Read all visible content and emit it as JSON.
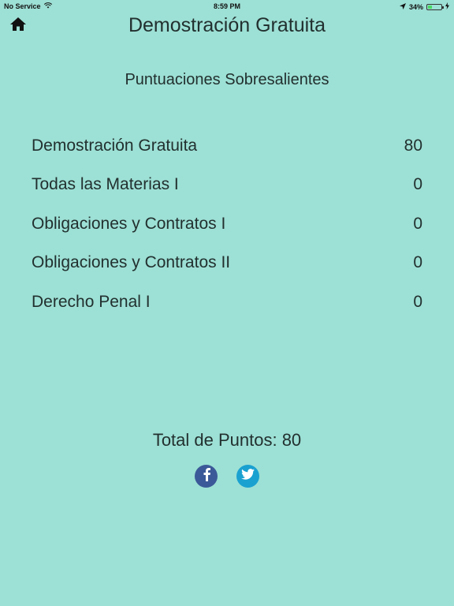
{
  "status_bar": {
    "carrier": "No Service",
    "time": "8:59 PM",
    "battery_percent": "34%",
    "battery_level": 0.34,
    "icons": [
      "wifi-icon",
      "location-arrow-icon",
      "battery-icon",
      "charging-bolt-icon"
    ]
  },
  "header": {
    "title": "Demostración Gratuita",
    "home_icon": "home-icon"
  },
  "scores": {
    "heading": "Puntuaciones Sobresalientes",
    "items": [
      {
        "name": "Demostración Gratuita",
        "score": "80"
      },
      {
        "name": "Todas las Materias I",
        "score": "0"
      },
      {
        "name": "Obligaciones y Contratos I",
        "score": "0"
      },
      {
        "name": "Obligaciones y Contratos II",
        "score": "0"
      },
      {
        "name": "Derecho Penal I",
        "score": "0"
      }
    ]
  },
  "total": {
    "label": "Total de Puntos: 80"
  },
  "social": {
    "facebook_icon": "facebook-icon",
    "twitter_icon": "twitter-icon",
    "facebook_color": "#3b5998",
    "twitter_color": "#1aa1d0"
  },
  "colors": {
    "background": "#9de0d5",
    "text": "#22302f",
    "battery_fill": "#4cd964"
  }
}
